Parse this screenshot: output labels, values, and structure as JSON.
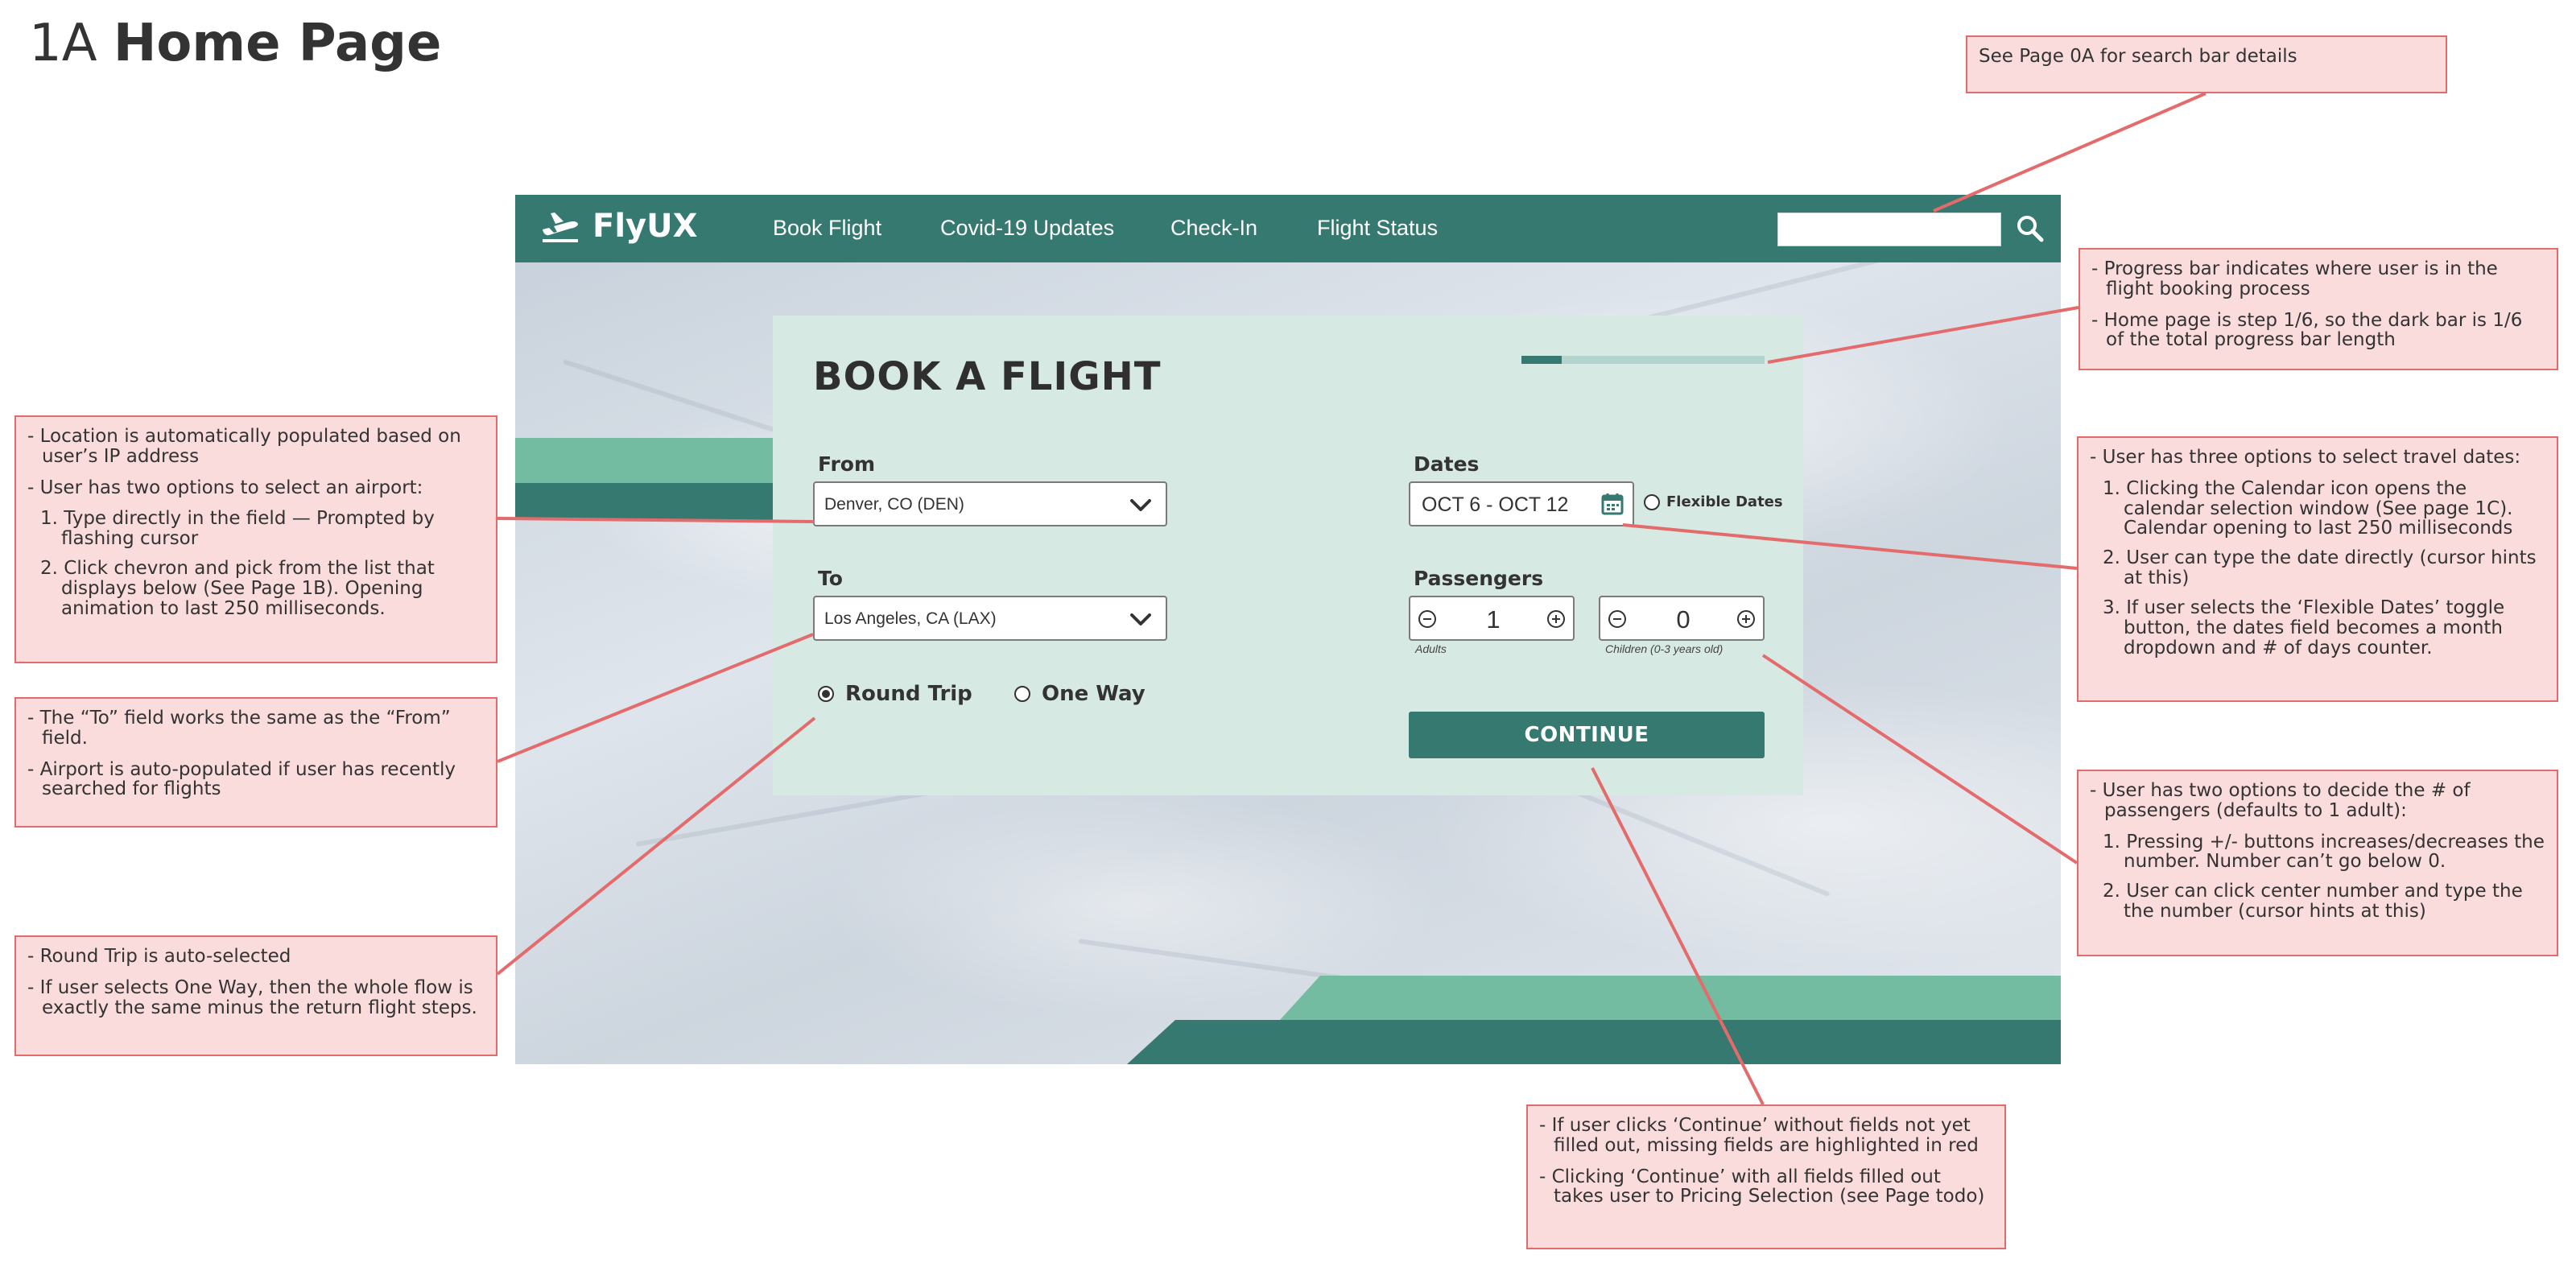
{
  "page": {
    "number": "1A",
    "title": "Home Page"
  },
  "navbar": {
    "brand": "FlyUX",
    "links": [
      "Book Flight",
      "Covid-19 Updates",
      "Check-In",
      "Flight Status"
    ],
    "search_value": "",
    "icons": {
      "logo": "airplane-takeoff-icon",
      "search": "search-icon"
    }
  },
  "booking": {
    "title": "BOOK A FLIGHT",
    "progress": {
      "step": 1,
      "total": 6,
      "fraction": 0.1667
    },
    "from": {
      "label": "From",
      "value": "Denver, CO (DEN)"
    },
    "to": {
      "label": "To",
      "value": "Los Angeles, CA (LAX)"
    },
    "dates": {
      "label": "Dates",
      "value": "OCT 6 - OCT 12",
      "flexible_label": "Flexible Dates",
      "flexible_selected": false
    },
    "passengers": {
      "label": "Passengers",
      "adults": {
        "value": "1",
        "caption": "Adults"
      },
      "children": {
        "value": "0",
        "caption": "Children (0-3 years old)"
      }
    },
    "trip": {
      "round_trip": {
        "label": "Round Trip",
        "selected": true
      },
      "one_way": {
        "label": "One Way",
        "selected": false
      }
    },
    "continue_label": "CONTINUE"
  },
  "colors": {
    "primary": "#357970",
    "card": "#d7e9e3",
    "band_light": "#73bca1",
    "note_fill": "#fbdcdc",
    "note_border": "#e46b6b"
  },
  "notes": {
    "search": "See Page 0A for search bar details",
    "progress": [
      "- Progress bar indicates where user is in the flight booking process",
      "- Home page is step 1/6, so the dark bar is 1/6 of the total progress bar length"
    ],
    "dates": {
      "intro": "- User has three options to select travel dates:",
      "items": [
        "1. Clicking the Calendar icon opens the calendar selection window  (See page 1C). Calendar opening to last 250 milliseconds",
        "2. User can type the date directly (cursor hints at this)",
        "3. If user selects the ‘Flexible Dates’ toggle button, the dates field becomes a month dropdown and # of days counter."
      ]
    },
    "passengers": {
      "intro": "- User has two options to decide the # of passengers (defaults to 1 adult):",
      "items": [
        "1. Pressing +/- buttons increases/decreases the number. Number can’t go below 0.",
        "2. User can click center number and type the the number (cursor hints at this)"
      ]
    },
    "continue": [
      "- If user clicks ‘Continue’ without fields not yet filled out, missing fields are highlighted in red",
      "- Clicking ‘Continue’ with all fields filled out takes user to Pricing Selection (see Page todo)"
    ],
    "from": {
      "intro": [
        "- Location is automatically populated based on user’s IP address",
        "- User has two options to select an airport:"
      ],
      "items": [
        "1. Type directly in the field — Prompted by flashing cursor",
        "2. Click chevron and pick from the list that displays below (See Page 1B). Opening animation to last 250 milliseconds."
      ]
    },
    "to": [
      "- The “To” field works the same as the “From” field.",
      "- Airport is auto-populated if user has recently searched for flights"
    ],
    "trip": [
      "- Round Trip is auto-selected",
      "- If user selects One Way, then the whole flow is exactly the same minus the return flight steps."
    ]
  }
}
